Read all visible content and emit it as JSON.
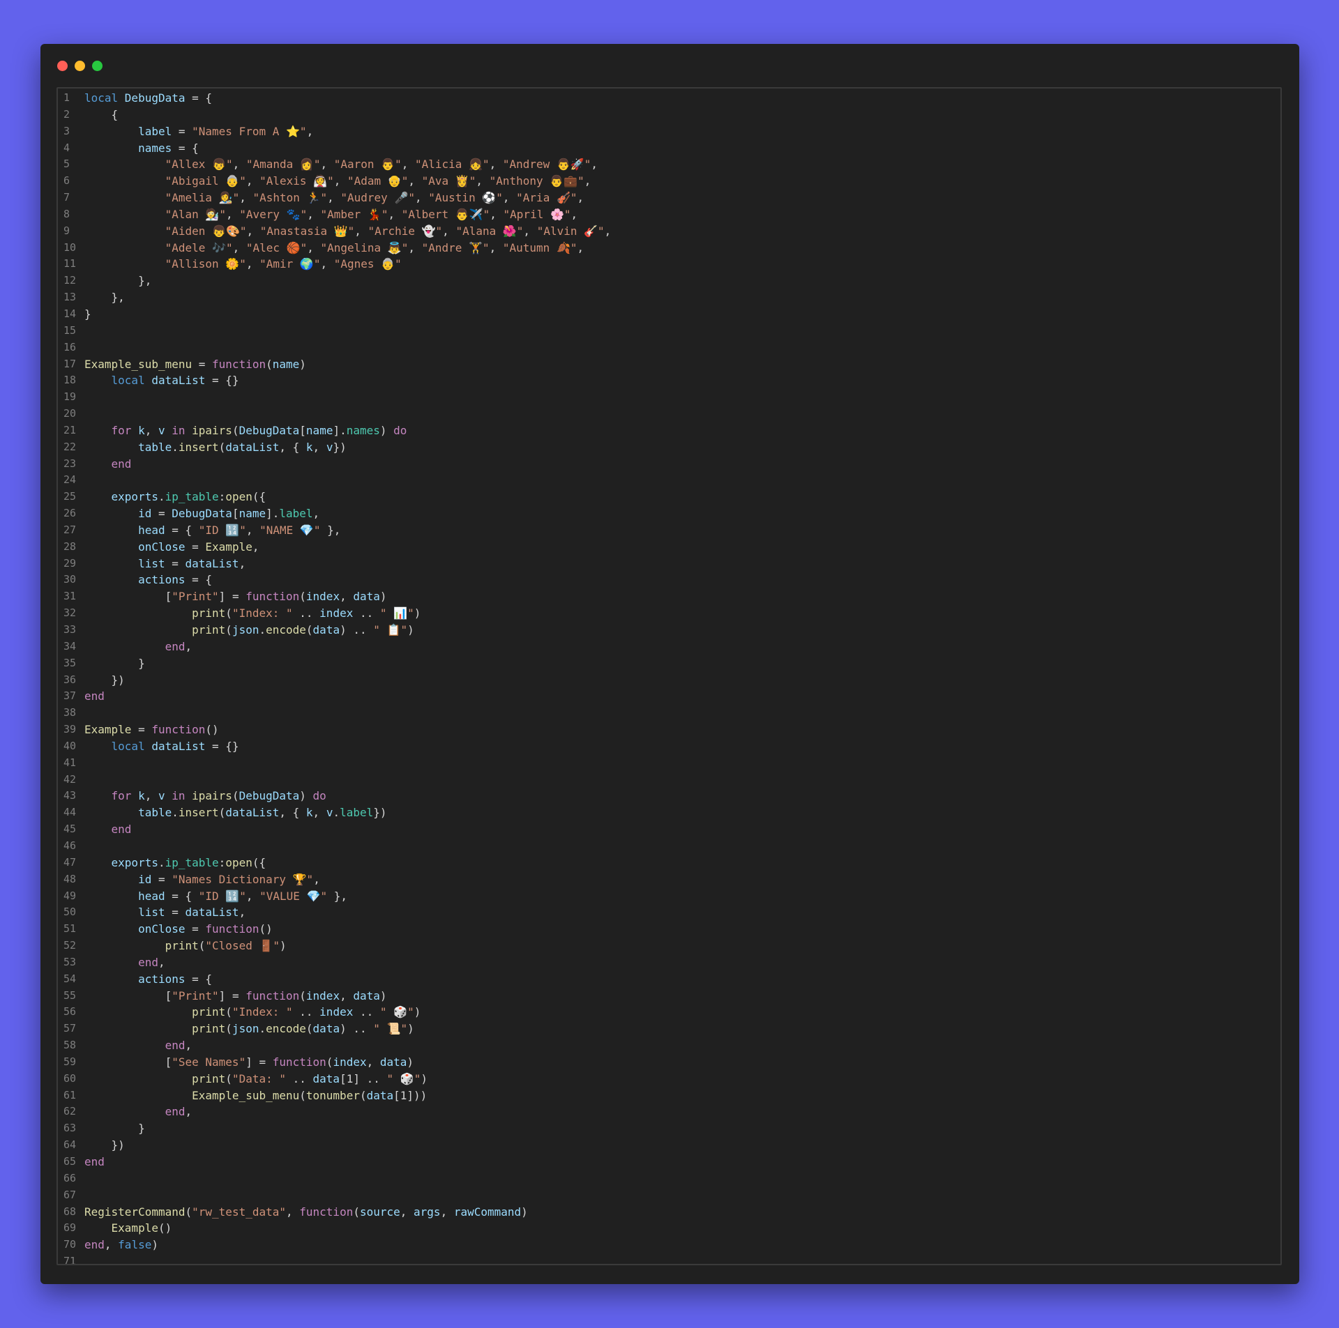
{
  "window": {
    "controls": [
      "close",
      "minimize",
      "maximize"
    ],
    "colors": {
      "close": "#ff5f57",
      "minimize": "#febc2e",
      "maximize": "#28c840"
    }
  },
  "editor": {
    "language": "lua",
    "lines": [
      [
        [
          "kw2",
          "local "
        ],
        [
          "var",
          "DebugData"
        ],
        [
          "p",
          " = {"
        ]
      ],
      [
        [
          "p",
          "    {"
        ]
      ],
      [
        [
          "var",
          "        label"
        ],
        [
          "p",
          " = "
        ],
        [
          "str",
          "\"Names From A ⭐\""
        ],
        [
          "p",
          ","
        ]
      ],
      [
        [
          "var",
          "        names"
        ],
        [
          "p",
          " = {"
        ]
      ],
      [
        [
          "str",
          "            \"Allex 👦\""
        ],
        [
          "p",
          ", "
        ],
        [
          "str",
          "\"Amanda 👩\""
        ],
        [
          "p",
          ", "
        ],
        [
          "str",
          "\"Aaron 👨\""
        ],
        [
          "p",
          ", "
        ],
        [
          "str",
          "\"Alicia 👧\""
        ],
        [
          "p",
          ", "
        ],
        [
          "str",
          "\"Andrew 👨🚀\""
        ],
        [
          "p",
          ","
        ]
      ],
      [
        [
          "str",
          "            \"Abigail 👵\""
        ],
        [
          "p",
          ", "
        ],
        [
          "str",
          "\"Alexis 👰\""
        ],
        [
          "p",
          ", "
        ],
        [
          "str",
          "\"Adam 👴\""
        ],
        [
          "p",
          ", "
        ],
        [
          "str",
          "\"Ava 👸\""
        ],
        [
          "p",
          ", "
        ],
        [
          "str",
          "\"Anthony 👨💼\""
        ],
        [
          "p",
          ","
        ]
      ],
      [
        [
          "str",
          "            \"Amelia 👩‍🎨\""
        ],
        [
          "p",
          ", "
        ],
        [
          "str",
          "\"Ashton 🏃\""
        ],
        [
          "p",
          ", "
        ],
        [
          "str",
          "\"Audrey 🎤\""
        ],
        [
          "p",
          ", "
        ],
        [
          "str",
          "\"Austin ⚽\""
        ],
        [
          "p",
          ", "
        ],
        [
          "str",
          "\"Aria 🎻\""
        ],
        [
          "p",
          ","
        ]
      ],
      [
        [
          "str",
          "            \"Alan 🧑‍🔬\""
        ],
        [
          "p",
          ", "
        ],
        [
          "str",
          "\"Avery 🐾\""
        ],
        [
          "p",
          ", "
        ],
        [
          "str",
          "\"Amber 💃\""
        ],
        [
          "p",
          ", "
        ],
        [
          "str",
          "\"Albert 👨✈️\""
        ],
        [
          "p",
          ", "
        ],
        [
          "str",
          "\"April 🌸\""
        ],
        [
          "p",
          ","
        ]
      ],
      [
        [
          "str",
          "            \"Aiden 👦🎨\""
        ],
        [
          "p",
          ", "
        ],
        [
          "str",
          "\"Anastasia 👑\""
        ],
        [
          "p",
          ", "
        ],
        [
          "str",
          "\"Archie 👻\""
        ],
        [
          "p",
          ", "
        ],
        [
          "str",
          "\"Alana 🌺\""
        ],
        [
          "p",
          ", "
        ],
        [
          "str",
          "\"Alvin 🎸\""
        ],
        [
          "p",
          ","
        ]
      ],
      [
        [
          "str",
          "            \"Adele 🎶\""
        ],
        [
          "p",
          ", "
        ],
        [
          "str",
          "\"Alec 🏀\""
        ],
        [
          "p",
          ", "
        ],
        [
          "str",
          "\"Angelina 👼\""
        ],
        [
          "p",
          ", "
        ],
        [
          "str",
          "\"Andre 🏋\""
        ],
        [
          "p",
          ", "
        ],
        [
          "str",
          "\"Autumn 🍂\""
        ],
        [
          "p",
          ","
        ]
      ],
      [
        [
          "str",
          "            \"Allison 🌼\""
        ],
        [
          "p",
          ", "
        ],
        [
          "str",
          "\"Amir 🌍\""
        ],
        [
          "p",
          ", "
        ],
        [
          "str",
          "\"Agnes 👵\""
        ]
      ],
      [
        [
          "p",
          "        },"
        ]
      ],
      [
        [
          "p",
          "    },"
        ]
      ],
      [
        [
          "p",
          "}"
        ]
      ],
      [],
      [],
      [
        [
          "fn",
          "Example_sub_menu"
        ],
        [
          "p",
          " = "
        ],
        [
          "kw",
          "function"
        ],
        [
          "p",
          "("
        ],
        [
          "var",
          "name"
        ],
        [
          "p",
          ")"
        ]
      ],
      [
        [
          "kw2",
          "    local "
        ],
        [
          "var",
          "dataList"
        ],
        [
          "p",
          " = {}"
        ]
      ],
      [],
      [],
      [
        [
          "kw",
          "    for "
        ],
        [
          "var",
          "k"
        ],
        [
          "p",
          ", "
        ],
        [
          "var",
          "v"
        ],
        [
          "kw",
          " in "
        ],
        [
          "fn",
          "ipairs"
        ],
        [
          "p",
          "("
        ],
        [
          "var",
          "DebugData"
        ],
        [
          "p",
          "["
        ],
        [
          "var",
          "name"
        ],
        [
          "p",
          "]."
        ],
        [
          "prop",
          "names"
        ],
        [
          "p",
          ") "
        ],
        [
          "kw",
          "do"
        ]
      ],
      [
        [
          "var",
          "        table"
        ],
        [
          "p",
          "."
        ],
        [
          "fn",
          "insert"
        ],
        [
          "p",
          "("
        ],
        [
          "var",
          "dataList"
        ],
        [
          "p",
          ", { "
        ],
        [
          "var",
          "k"
        ],
        [
          "p",
          ", "
        ],
        [
          "var",
          "v"
        ],
        [
          "p",
          "})"
        ]
      ],
      [
        [
          "kw",
          "    end"
        ]
      ],
      [],
      [
        [
          "var",
          "    exports"
        ],
        [
          "p",
          "."
        ],
        [
          "prop",
          "ip_table"
        ],
        [
          "p",
          ":"
        ],
        [
          "fn",
          "open"
        ],
        [
          "p",
          "({"
        ]
      ],
      [
        [
          "var",
          "        id"
        ],
        [
          "p",
          " = "
        ],
        [
          "var",
          "DebugData"
        ],
        [
          "p",
          "["
        ],
        [
          "var",
          "name"
        ],
        [
          "p",
          "]."
        ],
        [
          "prop",
          "label"
        ],
        [
          "p",
          ","
        ]
      ],
      [
        [
          "var",
          "        head"
        ],
        [
          "p",
          " = { "
        ],
        [
          "str",
          "\"ID 🔢\""
        ],
        [
          "p",
          ", "
        ],
        [
          "str",
          "\"NAME 💎\""
        ],
        [
          "p",
          " },"
        ]
      ],
      [
        [
          "var",
          "        onClose"
        ],
        [
          "p",
          " = "
        ],
        [
          "fn",
          "Example"
        ],
        [
          "p",
          ","
        ]
      ],
      [
        [
          "var",
          "        list"
        ],
        [
          "p",
          " = "
        ],
        [
          "var",
          "dataList"
        ],
        [
          "p",
          ","
        ]
      ],
      [
        [
          "var",
          "        actions"
        ],
        [
          "p",
          " = {"
        ]
      ],
      [
        [
          "p",
          "            ["
        ],
        [
          "str",
          "\"Print\""
        ],
        [
          "p",
          "] = "
        ],
        [
          "kw",
          "function"
        ],
        [
          "p",
          "("
        ],
        [
          "var",
          "index"
        ],
        [
          "p",
          ", "
        ],
        [
          "var",
          "data"
        ],
        [
          "p",
          ")"
        ]
      ],
      [
        [
          "fn",
          "                print"
        ],
        [
          "p",
          "("
        ],
        [
          "str",
          "\"Index: \""
        ],
        [
          "p",
          " .. "
        ],
        [
          "var",
          "index"
        ],
        [
          "p",
          " .. "
        ],
        [
          "str",
          "\" 📊\""
        ],
        [
          "p",
          ")"
        ]
      ],
      [
        [
          "fn",
          "                print"
        ],
        [
          "p",
          "("
        ],
        [
          "var",
          "json"
        ],
        [
          "p",
          "."
        ],
        [
          "fn",
          "encode"
        ],
        [
          "p",
          "("
        ],
        [
          "var",
          "data"
        ],
        [
          "p",
          ") .. "
        ],
        [
          "str",
          "\" 📋\""
        ],
        [
          "p",
          ")"
        ]
      ],
      [
        [
          "kw",
          "            end"
        ],
        [
          "p",
          ","
        ]
      ],
      [
        [
          "p",
          "        }"
        ]
      ],
      [
        [
          "p",
          "    })"
        ]
      ],
      [
        [
          "kw",
          "end"
        ]
      ],
      [],
      [
        [
          "fn",
          "Example"
        ],
        [
          "p",
          " = "
        ],
        [
          "kw",
          "function"
        ],
        [
          "p",
          "()"
        ]
      ],
      [
        [
          "kw2",
          "    local "
        ],
        [
          "var",
          "dataList"
        ],
        [
          "p",
          " = {}"
        ]
      ],
      [],
      [],
      [
        [
          "kw",
          "    for "
        ],
        [
          "var",
          "k"
        ],
        [
          "p",
          ", "
        ],
        [
          "var",
          "v"
        ],
        [
          "kw",
          " in "
        ],
        [
          "fn",
          "ipairs"
        ],
        [
          "p",
          "("
        ],
        [
          "var",
          "DebugData"
        ],
        [
          "p",
          ") "
        ],
        [
          "kw",
          "do"
        ]
      ],
      [
        [
          "var",
          "        table"
        ],
        [
          "p",
          "."
        ],
        [
          "fn",
          "insert"
        ],
        [
          "p",
          "("
        ],
        [
          "var",
          "dataList"
        ],
        [
          "p",
          ", { "
        ],
        [
          "var",
          "k"
        ],
        [
          "p",
          ", "
        ],
        [
          "var",
          "v"
        ],
        [
          "p",
          "."
        ],
        [
          "prop",
          "label"
        ],
        [
          "p",
          "})"
        ]
      ],
      [
        [
          "kw",
          "    end"
        ]
      ],
      [],
      [
        [
          "var",
          "    exports"
        ],
        [
          "p",
          "."
        ],
        [
          "prop",
          "ip_table"
        ],
        [
          "p",
          ":"
        ],
        [
          "fn",
          "open"
        ],
        [
          "p",
          "({"
        ]
      ],
      [
        [
          "var",
          "        id"
        ],
        [
          "p",
          " = "
        ],
        [
          "str",
          "\"Names Dictionary 🏆\""
        ],
        [
          "p",
          ","
        ]
      ],
      [
        [
          "var",
          "        head"
        ],
        [
          "p",
          " = { "
        ],
        [
          "str",
          "\"ID 🔢\""
        ],
        [
          "p",
          ", "
        ],
        [
          "str",
          "\"VALUE 💎\""
        ],
        [
          "p",
          " },"
        ]
      ],
      [
        [
          "var",
          "        list"
        ],
        [
          "p",
          " = "
        ],
        [
          "var",
          "dataList"
        ],
        [
          "p",
          ","
        ]
      ],
      [
        [
          "var",
          "        onClose"
        ],
        [
          "p",
          " = "
        ],
        [
          "kw",
          "function"
        ],
        [
          "p",
          "()"
        ]
      ],
      [
        [
          "fn",
          "            print"
        ],
        [
          "p",
          "("
        ],
        [
          "str",
          "\"Closed 🚪\""
        ],
        [
          "p",
          ")"
        ]
      ],
      [
        [
          "kw",
          "        end"
        ],
        [
          "p",
          ","
        ]
      ],
      [
        [
          "var",
          "        actions"
        ],
        [
          "p",
          " = {"
        ]
      ],
      [
        [
          "p",
          "            ["
        ],
        [
          "str",
          "\"Print\""
        ],
        [
          "p",
          "] = "
        ],
        [
          "kw",
          "function"
        ],
        [
          "p",
          "("
        ],
        [
          "var",
          "index"
        ],
        [
          "p",
          ", "
        ],
        [
          "var",
          "data"
        ],
        [
          "p",
          ")"
        ]
      ],
      [
        [
          "fn",
          "                print"
        ],
        [
          "p",
          "("
        ],
        [
          "str",
          "\"Index: \""
        ],
        [
          "p",
          " .. "
        ],
        [
          "var",
          "index"
        ],
        [
          "p",
          " .. "
        ],
        [
          "str",
          "\" 🎲\""
        ],
        [
          "p",
          ")"
        ]
      ],
      [
        [
          "fn",
          "                print"
        ],
        [
          "p",
          "("
        ],
        [
          "var",
          "json"
        ],
        [
          "p",
          "."
        ],
        [
          "fn",
          "encode"
        ],
        [
          "p",
          "("
        ],
        [
          "var",
          "data"
        ],
        [
          "p",
          ") .. "
        ],
        [
          "str",
          "\" 📜\""
        ],
        [
          "p",
          ")"
        ]
      ],
      [
        [
          "kw",
          "            end"
        ],
        [
          "p",
          ","
        ]
      ],
      [
        [
          "p",
          "            ["
        ],
        [
          "str",
          "\"See Names\""
        ],
        [
          "p",
          "] = "
        ],
        [
          "kw",
          "function"
        ],
        [
          "p",
          "("
        ],
        [
          "var",
          "index"
        ],
        [
          "p",
          ", "
        ],
        [
          "var",
          "data"
        ],
        [
          "p",
          ")"
        ]
      ],
      [
        [
          "fn",
          "                print"
        ],
        [
          "p",
          "("
        ],
        [
          "str",
          "\"Data: \""
        ],
        [
          "p",
          " .. "
        ],
        [
          "var",
          "data"
        ],
        [
          "p",
          "[1] .. "
        ],
        [
          "str",
          "\" 🎲\""
        ],
        [
          "p",
          ")"
        ]
      ],
      [
        [
          "fn",
          "                Example_sub_menu"
        ],
        [
          "p",
          "("
        ],
        [
          "fn",
          "tonumber"
        ],
        [
          "p",
          "("
        ],
        [
          "var",
          "data"
        ],
        [
          "p",
          "[1]))"
        ]
      ],
      [
        [
          "kw",
          "            end"
        ],
        [
          "p",
          ","
        ]
      ],
      [
        [
          "p",
          "        }"
        ]
      ],
      [
        [
          "p",
          "    })"
        ]
      ],
      [
        [
          "kw",
          "end"
        ]
      ],
      [],
      [],
      [
        [
          "fn",
          "RegisterCommand"
        ],
        [
          "p",
          "("
        ],
        [
          "str",
          "\"rw_test_data\""
        ],
        [
          "p",
          ", "
        ],
        [
          "kw",
          "function"
        ],
        [
          "p",
          "("
        ],
        [
          "var",
          "source"
        ],
        [
          "p",
          ", "
        ],
        [
          "var",
          "args"
        ],
        [
          "p",
          ", "
        ],
        [
          "var",
          "rawCommand"
        ],
        [
          "p",
          ")"
        ]
      ],
      [
        [
          "fn",
          "    Example"
        ],
        [
          "p",
          "()"
        ]
      ],
      [
        [
          "kw",
          "end"
        ],
        [
          "p",
          ", "
        ],
        [
          "bool",
          "false"
        ],
        [
          "p",
          ")"
        ]
      ],
      []
    ]
  }
}
